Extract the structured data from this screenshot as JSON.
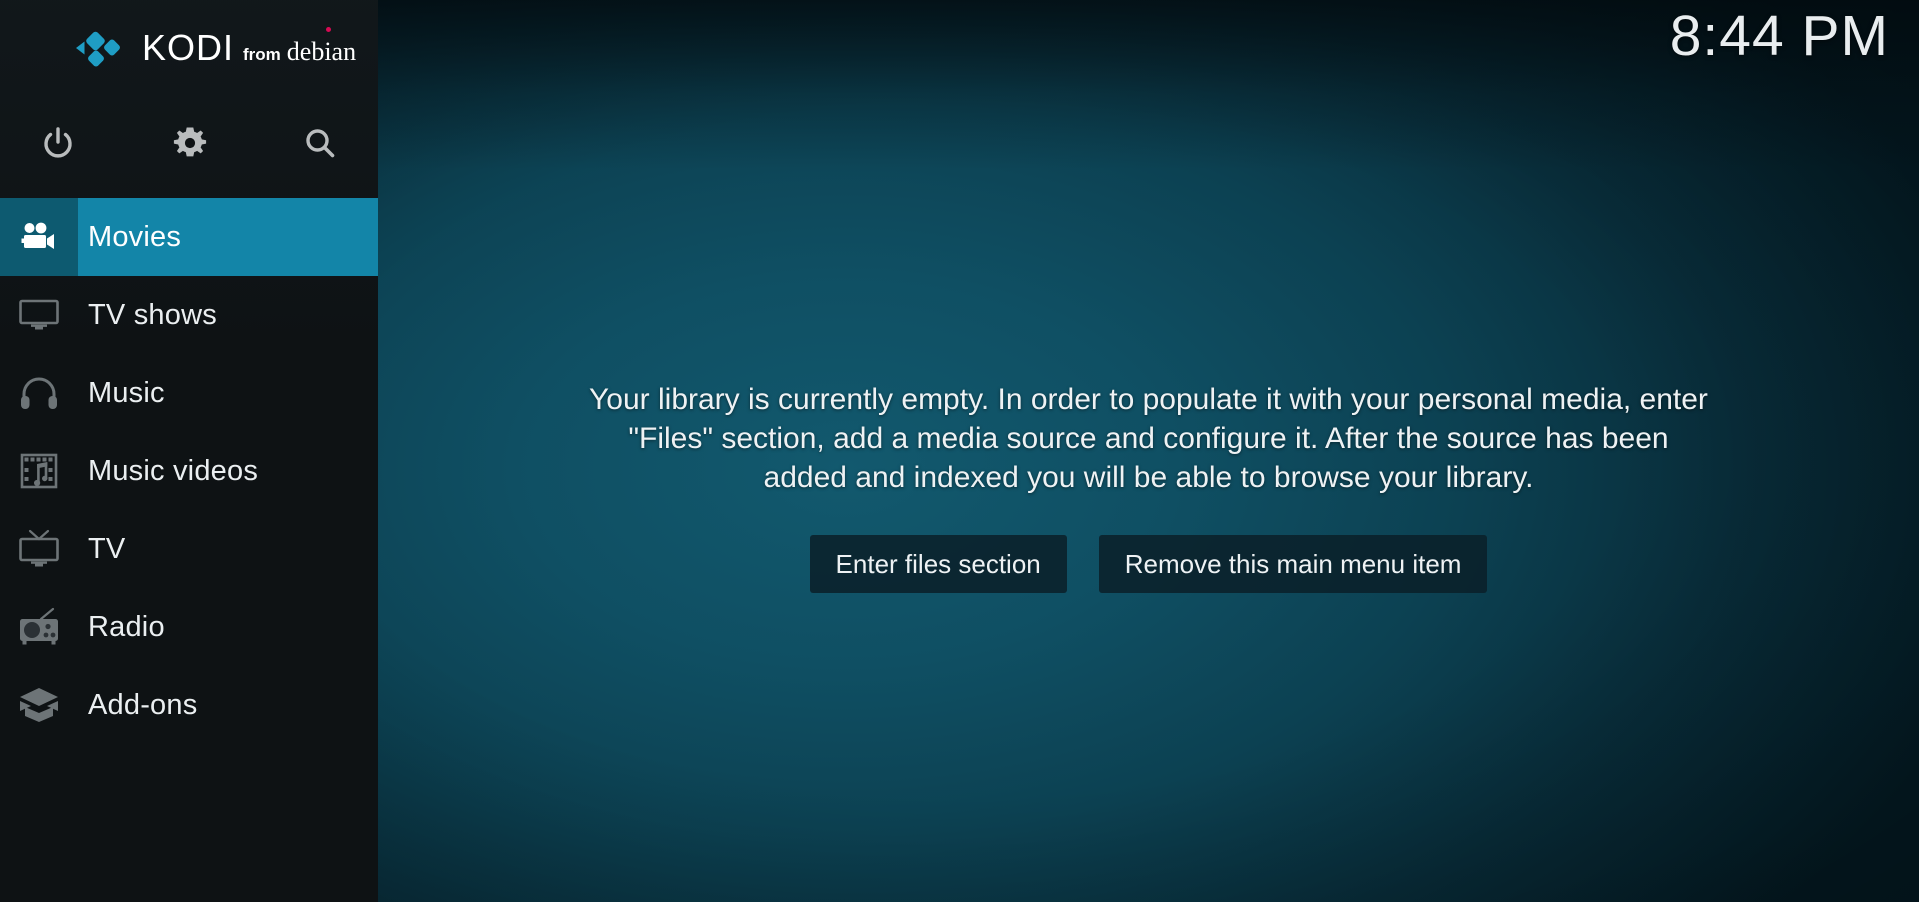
{
  "app": {
    "name": "Kodi",
    "logo_primary": "KODI",
    "logo_from": "from",
    "logo_distro": "debian",
    "accent_color": "#1385a8",
    "accent_dark_color": "#0d5a70",
    "logo_blue": "#1f9dc4",
    "debian_red": "#d70a53",
    "sidebar_bg": "#0e1214"
  },
  "header": {
    "clock": "8:44 PM"
  },
  "quick_actions": [
    {
      "name": "power-button",
      "icon": "power-icon",
      "label": "Power"
    },
    {
      "name": "settings-button",
      "icon": "gear-icon",
      "label": "Settings"
    },
    {
      "name": "search-button",
      "icon": "search-icon",
      "label": "Search"
    }
  ],
  "sidebar": {
    "items": [
      {
        "label": "Movies",
        "icon": "movie-camera-icon",
        "selected": true
      },
      {
        "label": "TV shows",
        "icon": "monitor-icon",
        "selected": false
      },
      {
        "label": "Music",
        "icon": "headphones-icon",
        "selected": false
      },
      {
        "label": "Music videos",
        "icon": "film-music-icon",
        "selected": false
      },
      {
        "label": "TV",
        "icon": "tv-antenna-icon",
        "selected": false
      },
      {
        "label": "Radio",
        "icon": "radio-icon",
        "selected": false
      },
      {
        "label": "Add-ons",
        "icon": "open-box-icon",
        "selected": false
      }
    ]
  },
  "main": {
    "empty_message": "Your library is currently empty. In order to populate it with your personal media, enter \"Files\" section, add a media source and configure it. After the source has been added and indexed you will be able to browse your library.",
    "buttons": [
      {
        "label": "Enter files section",
        "name": "enter-files-section-button"
      },
      {
        "label": "Remove this main menu item",
        "name": "remove-main-menu-item-button"
      }
    ]
  }
}
